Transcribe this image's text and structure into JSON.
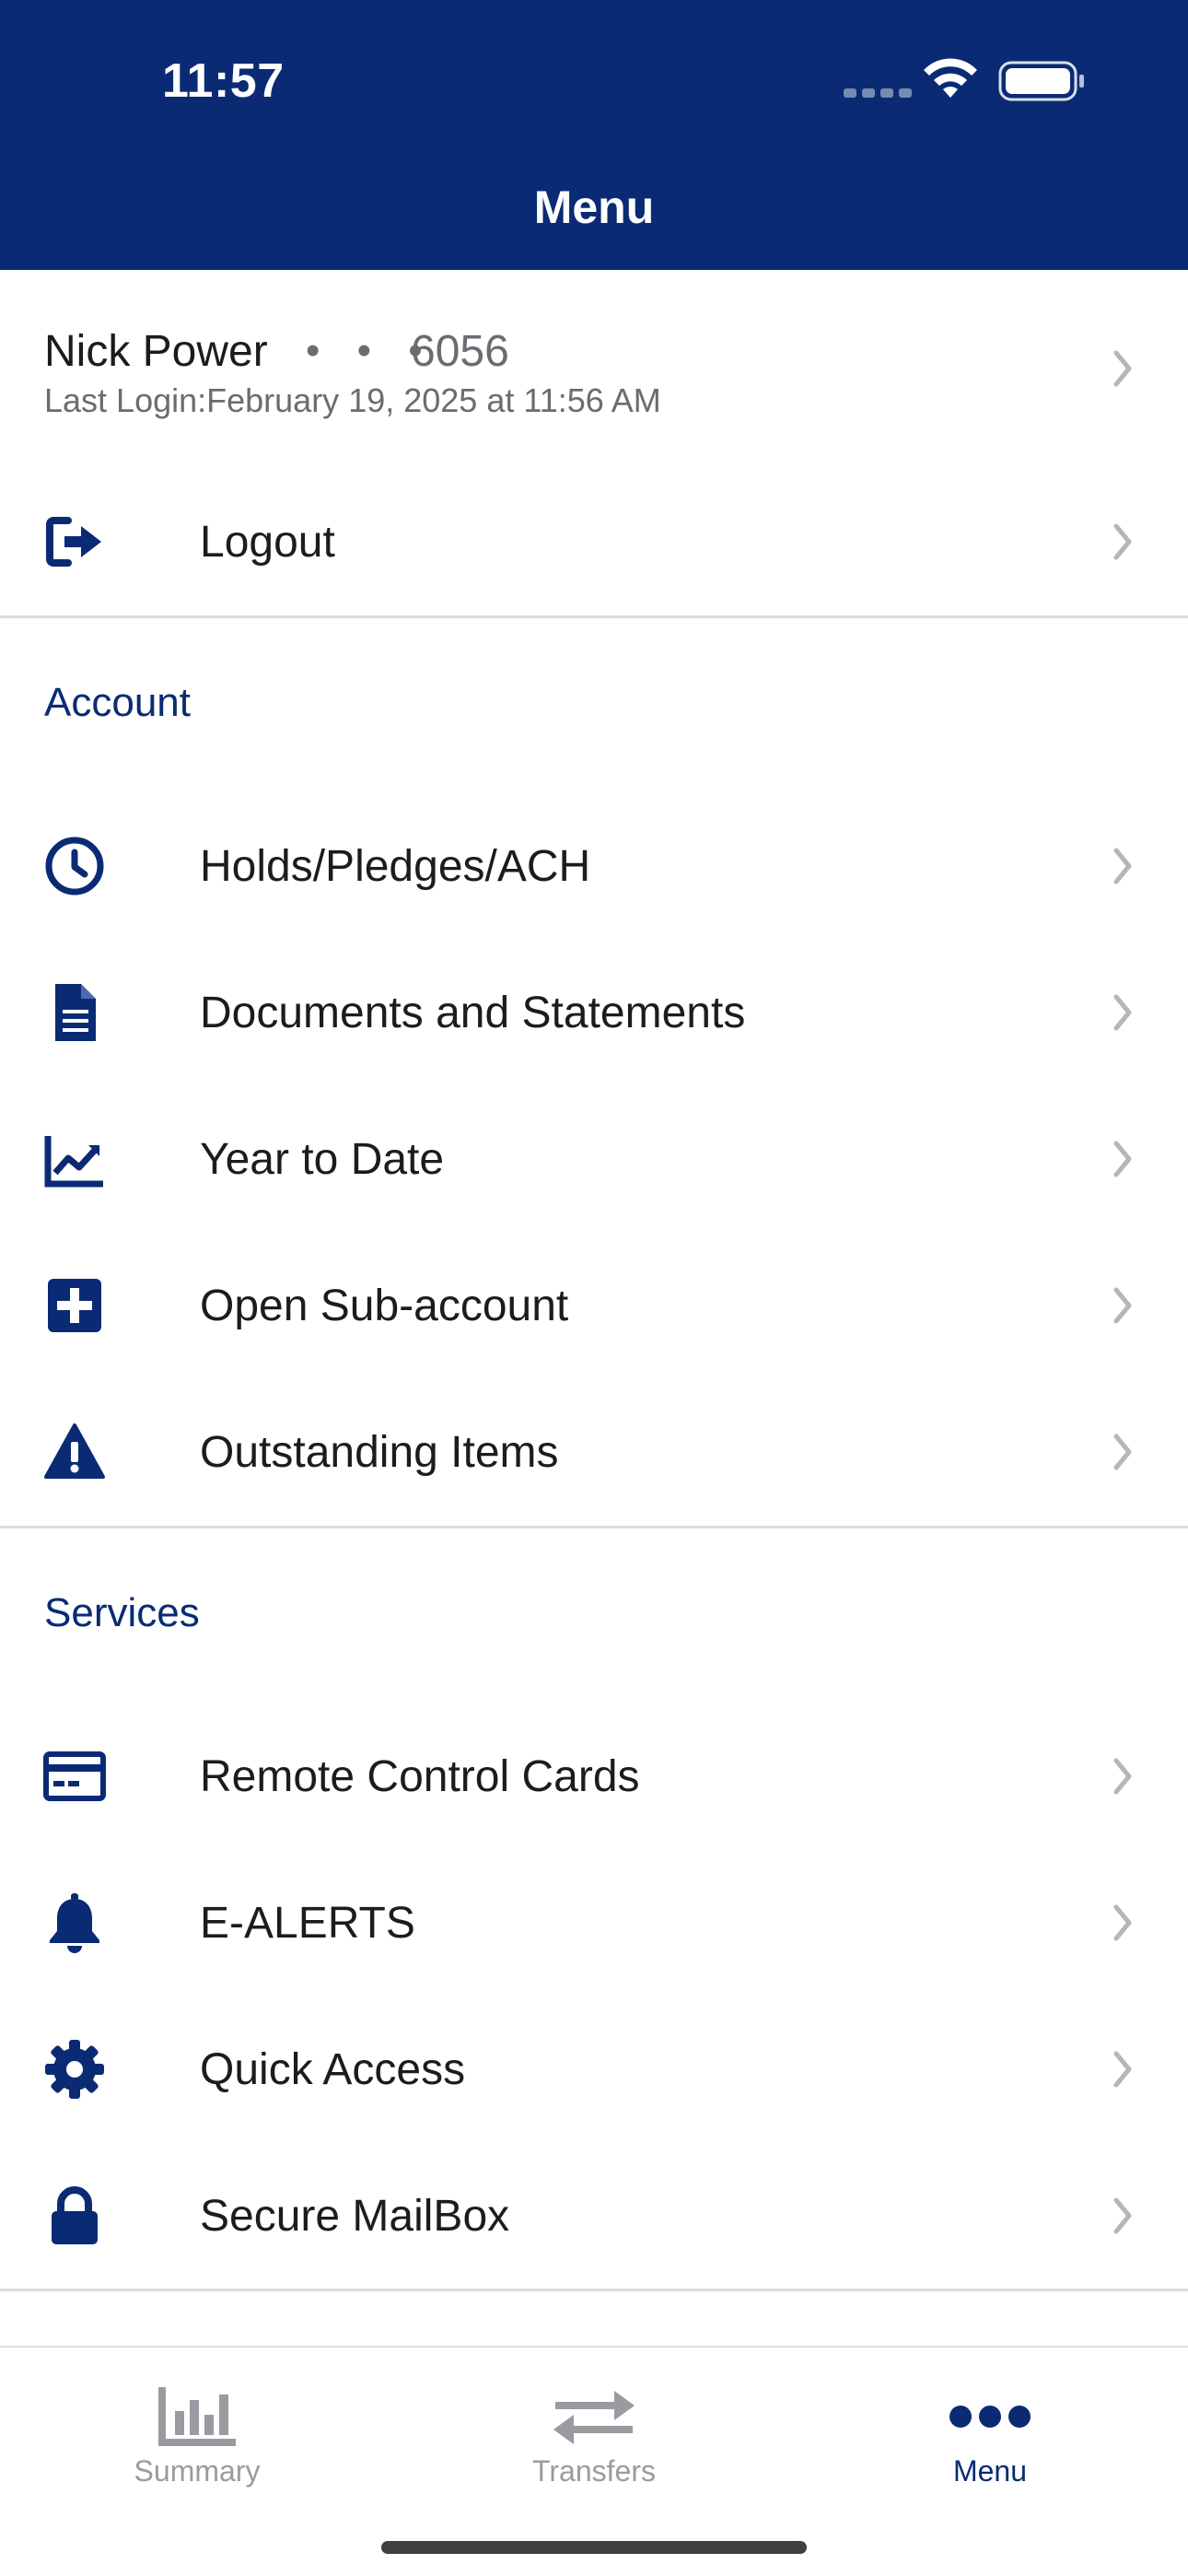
{
  "status": {
    "time": "11:57"
  },
  "header": {
    "title": "Menu"
  },
  "user": {
    "name": "Nick Power",
    "dots": "• • •",
    "account": "6056",
    "last_login": "Last Login:February 19, 2025 at 11:56 AM"
  },
  "logout": {
    "label": "Logout"
  },
  "sections": {
    "account": {
      "title": "Account",
      "items": [
        {
          "label": "Holds/Pledges/ACH",
          "icon": "clock-icon"
        },
        {
          "label": "Documents and Statements",
          "icon": "document-icon"
        },
        {
          "label": "Year to Date",
          "icon": "trend-chart-icon"
        },
        {
          "label": "Open Sub-account",
          "icon": "plus-square-icon"
        },
        {
          "label": "Outstanding Items",
          "icon": "warning-icon"
        }
      ]
    },
    "services": {
      "title": "Services",
      "items": [
        {
          "label": "Remote Control Cards",
          "icon": "credit-card-icon"
        },
        {
          "label": "E-ALERTS",
          "icon": "bell-icon"
        },
        {
          "label": "Quick Access",
          "icon": "gear-icon"
        },
        {
          "label": "Secure MailBox",
          "icon": "lock-icon"
        }
      ]
    }
  },
  "tabbar": {
    "tabs": [
      {
        "label": "Summary",
        "icon": "bar-chart-icon",
        "active": false
      },
      {
        "label": "Transfers",
        "icon": "transfer-arrows-icon",
        "active": false
      },
      {
        "label": "Menu",
        "icon": "more-dots-icon",
        "active": true
      }
    ]
  },
  "colors": {
    "brand": "#0a2b74",
    "inactive": "#9a9aa0",
    "divider": "#dcdce0"
  }
}
